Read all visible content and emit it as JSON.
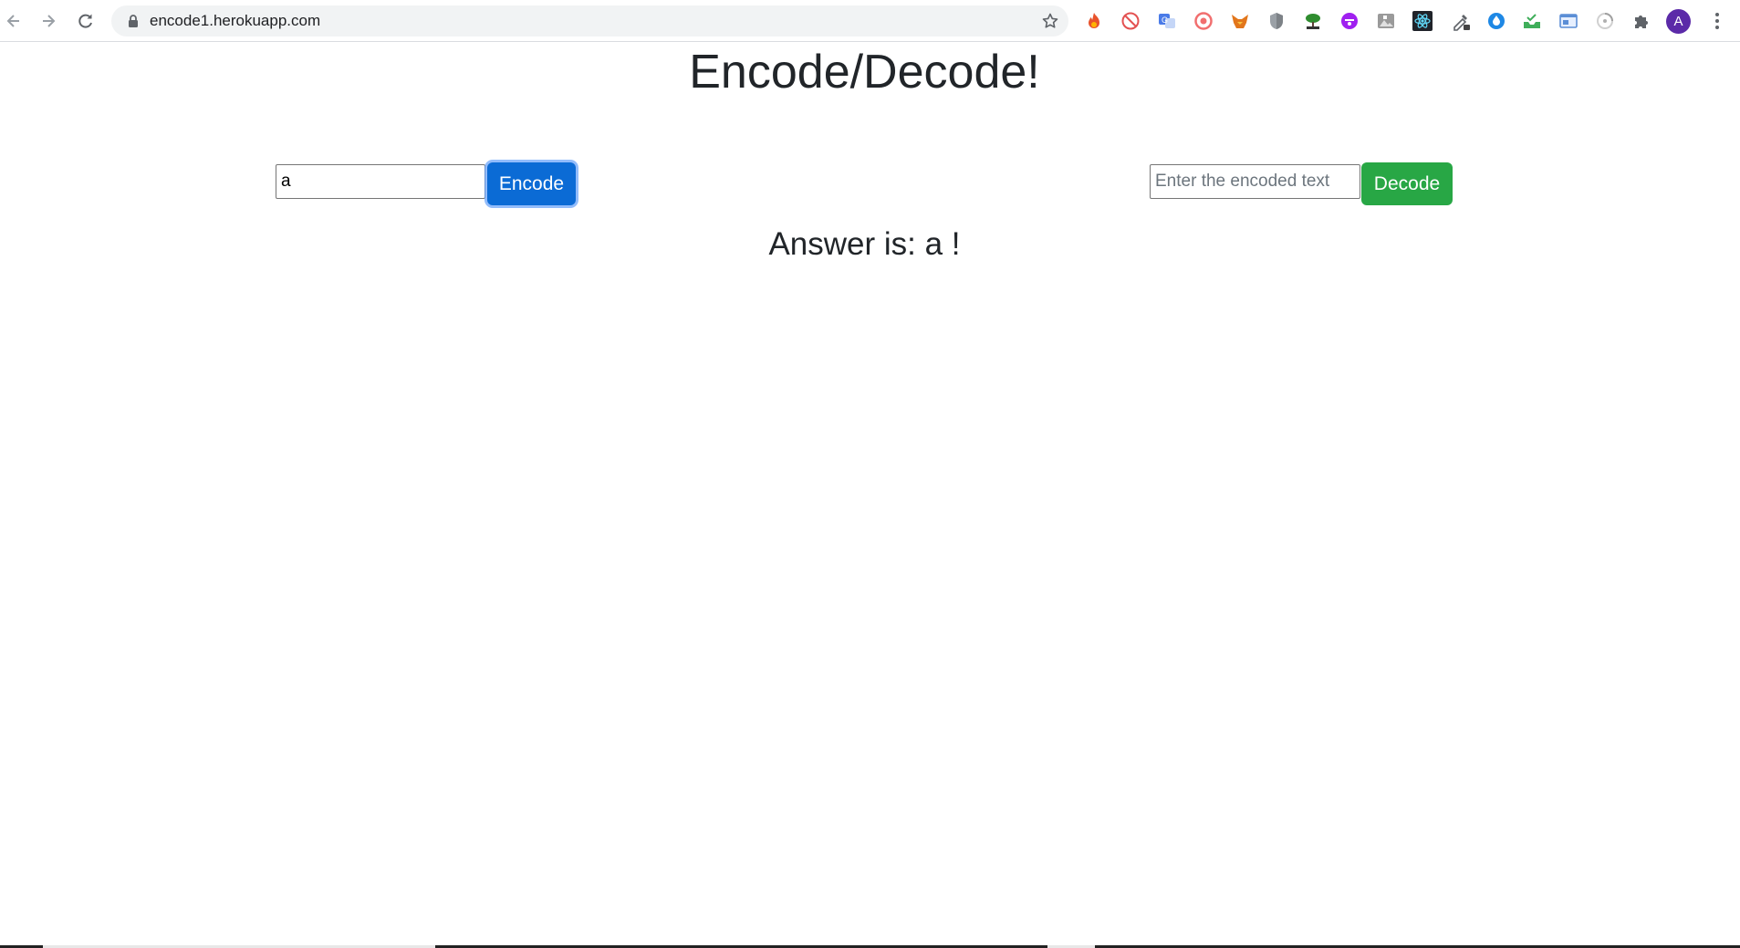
{
  "browser": {
    "url": "encode1.herokuapp.com",
    "profile_initial": "A",
    "extensions": [
      {
        "icon": "fire-icon",
        "color": "#e8532c"
      },
      {
        "icon": "no-sign-icon",
        "color": "#e35151"
      },
      {
        "icon": "translate-icon",
        "color": "#4a7be8"
      },
      {
        "icon": "circle-badge-icon",
        "color": "#f16f6f"
      },
      {
        "icon": "fox-icon",
        "color": "#e2761b"
      },
      {
        "icon": "shield-icon",
        "color": "#9aa0a6"
      },
      {
        "icon": "tree-icon",
        "color": "#2f8d2f"
      },
      {
        "icon": "emoji-icon",
        "color": "#a020f0"
      },
      {
        "icon": "photo-icon",
        "color": "#7b7b7b"
      },
      {
        "icon": "react-icon",
        "color": "#61dafb"
      },
      {
        "icon": "eyedropper-icon",
        "color": "#5f6368"
      },
      {
        "icon": "drop-icon",
        "color": "#1e88e5"
      },
      {
        "icon": "check-tray-icon",
        "color": "#3fae5a"
      },
      {
        "icon": "window-icon",
        "color": "#5b8ed6"
      },
      {
        "icon": "spinner-icon",
        "color": "#b0b0b0"
      },
      {
        "icon": "puzzle-icon",
        "color": "#5f6368"
      }
    ]
  },
  "page": {
    "title": "Encode/Decode!",
    "encode": {
      "value": "a",
      "button_label": "Encode",
      "button_color": "#0b6bd5"
    },
    "decode": {
      "value": "",
      "placeholder": "Enter the encoded text",
      "button_label": "Decode",
      "button_color": "#28a745"
    },
    "answer": "Answer is: a !"
  }
}
